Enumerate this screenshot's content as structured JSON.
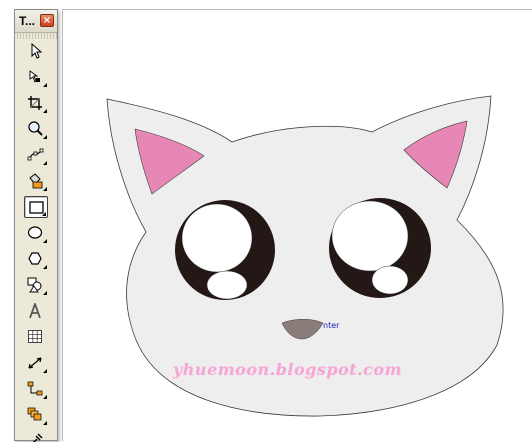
{
  "toolbox": {
    "title": "T...",
    "close_glyph": "×",
    "tools": [
      {
        "name": "pick-tool-icon",
        "active": false
      },
      {
        "name": "shape-tool-icon",
        "active": false
      },
      {
        "name": "crop-tool-icon",
        "active": false
      },
      {
        "name": "zoom-tool-icon",
        "active": false
      },
      {
        "name": "freehand-tool-icon",
        "active": false
      },
      {
        "name": "smart-fill-tool-icon",
        "active": false
      },
      {
        "name": "rectangle-tool-icon",
        "active": true
      },
      {
        "name": "ellipse-tool-icon",
        "active": false
      },
      {
        "name": "polygon-tool-icon",
        "active": false
      },
      {
        "name": "basic-shapes-tool-icon",
        "active": false
      },
      {
        "name": "text-tool-icon",
        "active": false
      },
      {
        "name": "table-tool-icon",
        "active": false
      },
      {
        "name": "dimension-tool-icon",
        "active": false
      },
      {
        "name": "connector-tool-icon",
        "active": false
      },
      {
        "name": "blend-tool-icon",
        "active": false
      },
      {
        "name": "eyedropper-tool-icon",
        "active": false
      }
    ]
  },
  "canvas": {
    "snap_label": "nter",
    "watermark": "yhuemoon.blogspot.com"
  },
  "colors": {
    "cat_fill": "#eeeeee",
    "inner_ear": "#e787b5",
    "eye_dark": "#231815",
    "eye_highlight": "#ffffff",
    "nose": "#8a7c78",
    "outline": "#3a3a3a",
    "watermark": "#f6a6d4",
    "snap_label": "#1b1bb8"
  }
}
